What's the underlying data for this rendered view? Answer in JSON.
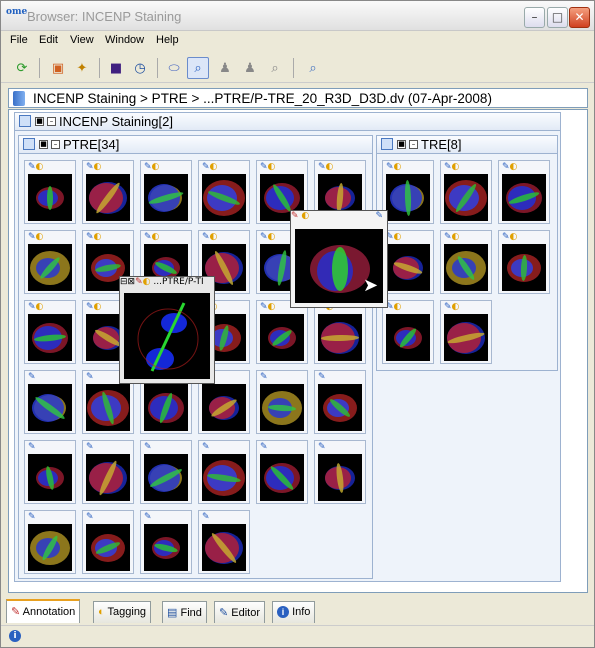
{
  "window": {
    "title": "Browser: INCENP Staining",
    "logo_text": "ome"
  },
  "menu": [
    "File",
    "Edit",
    "View",
    "Window",
    "Help"
  ],
  "breadcrumb": "INCENP Staining > PTRE > ...PTRE/P-TRE_20_R3D_D3D.dv (07-Apr-2008)",
  "root_panel": {
    "title": "INCENP Staining[2]"
  },
  "ptre_panel": {
    "title": "PTRE[34]"
  },
  "tre_panel": {
    "title": "TRE[8]"
  },
  "popup_small": {
    "title": "...PTRE/P-TI"
  },
  "tabs": [
    "Annotation",
    "Tagging",
    "Find",
    "Editor",
    "Info"
  ],
  "status": {
    "icon": "info-icon"
  },
  "colors": {
    "accent": "#e8a020",
    "frame": "#7f9db9",
    "panel": "#eef3fa"
  }
}
